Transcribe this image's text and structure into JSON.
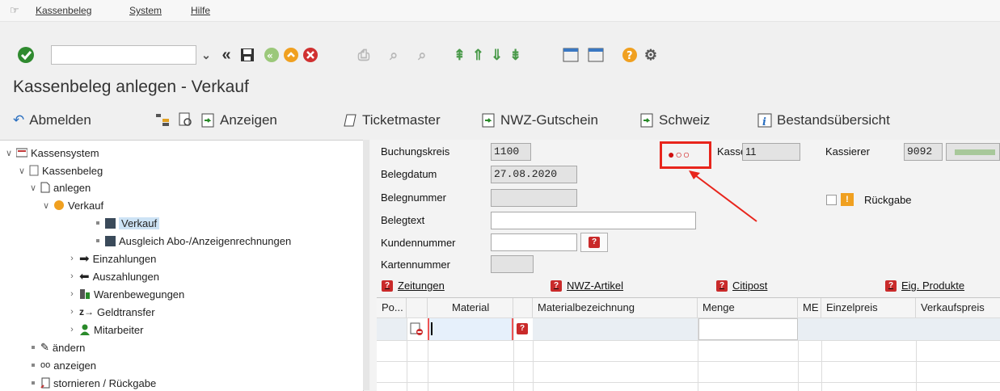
{
  "menu": {
    "items": [
      "Kassenbeleg",
      "System",
      "Hilfe"
    ]
  },
  "title": "Kassenbeleg anlegen - Verkauf",
  "app_toolbar": {
    "abmelden": "Abmelden",
    "anzeigen": "Anzeigen",
    "ticketmaster": "Ticketmaster",
    "nwz_gutschein": "NWZ-Gutschein",
    "schweiz": "Schweiz",
    "bestand": "Bestandsübersicht"
  },
  "tree": {
    "kassensystem": "Kassensystem",
    "kassenbeleg": "Kassenbeleg",
    "anlegen": "anlegen",
    "verkauf_folder": "Verkauf",
    "verkauf": "Verkauf",
    "ausgleich": "Ausgleich Abo-/Anzeigenrechnungen",
    "einzahlungen": "Einzahlungen",
    "auszahlungen": "Auszahlungen",
    "warenbewegungen": "Warenbewegungen",
    "geldtransfer": "Geldtransfer",
    "mitarbeiter": "Mitarbeiter",
    "aendern": "ändern",
    "anzeigen": "anzeigen",
    "stornieren": "stornieren / Rückgabe"
  },
  "form": {
    "buchungskreis_label": "Buchungskreis",
    "buchungskreis_value": "1100",
    "belegdatum_label": "Belegdatum",
    "belegdatum_value": "27.08.2020",
    "belegnummer_label": "Belegnummer",
    "belegtext_label": "Belegtext",
    "kundennummer_label": "Kundennummer",
    "kartennummer_label": "Kartennummer",
    "status_indicator": "●○○",
    "kasse_label": "Kasse",
    "kasse_value": "11",
    "kassierer_label": "Kassierer",
    "kassierer_value": "9092",
    "rueckgabe_label": "Rückgabe"
  },
  "links": {
    "zeitungen": "Zeitungen",
    "nwz_artikel": "NWZ-Artikel",
    "citipost": "Citipost",
    "eig_produkte": "Eig. Produkte"
  },
  "table": {
    "headers": [
      "Po...",
      "Material",
      "Materialbezeichnung",
      "Menge",
      "ME",
      "Einzelpreis",
      "Verkaufspreis"
    ]
  },
  "colors": {
    "highlight": "#e8251c",
    "status_red": "#d01010",
    "help_red": "#c92a2a"
  }
}
